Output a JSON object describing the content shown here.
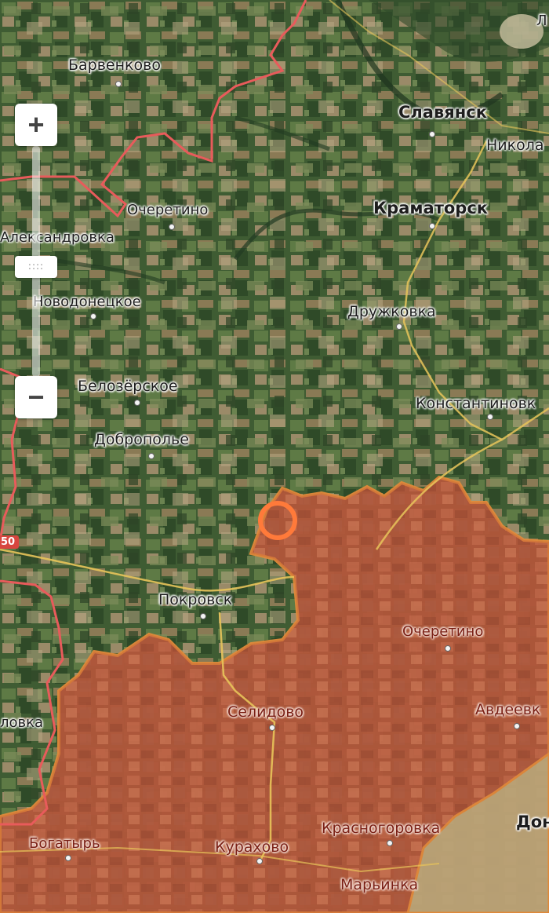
{
  "map": {
    "colors": {
      "terrain": "#3e5a33",
      "occupied_fill": "#c85a3a",
      "occupied_border": "#e08a3a",
      "admin_border": "#e85b5b",
      "road": "#e8c45a",
      "marker": "#ff7a3a"
    },
    "labels": {
      "barvenkovo": "Барвенково",
      "slavyansk": "Славянск",
      "nikolaevka": "Никола",
      "kramatorsk": "Краматорск",
      "ocheretino_n": "Очеретино",
      "aleksandrovka": "Александровка",
      "novodonetskoe": "Новодонецкое",
      "druzhkovka": "Дружковка",
      "belozerskoe": "Белозёрское",
      "konstantinovka": "Константиновк",
      "dobropolye": "Доброполье",
      "pokrovsk": "Покровск",
      "ocheretino_s": "Очеретино",
      "selidovo": "Селидово",
      "avdeevka": "Авдеевк",
      "lovka": "ловка",
      "bogatyr": "Богатырь",
      "kurakhovo": "Курахово",
      "krasnogorovka": "Красногоровка",
      "donetsk": "Дон",
      "marinka": "Марьинка",
      "corner_l": "Л"
    },
    "route_shield": "50",
    "controls": {
      "zoom_in": "+",
      "zoom_out": "−",
      "slider_grip": "::::"
    },
    "marker_icon": "circle-marker"
  }
}
